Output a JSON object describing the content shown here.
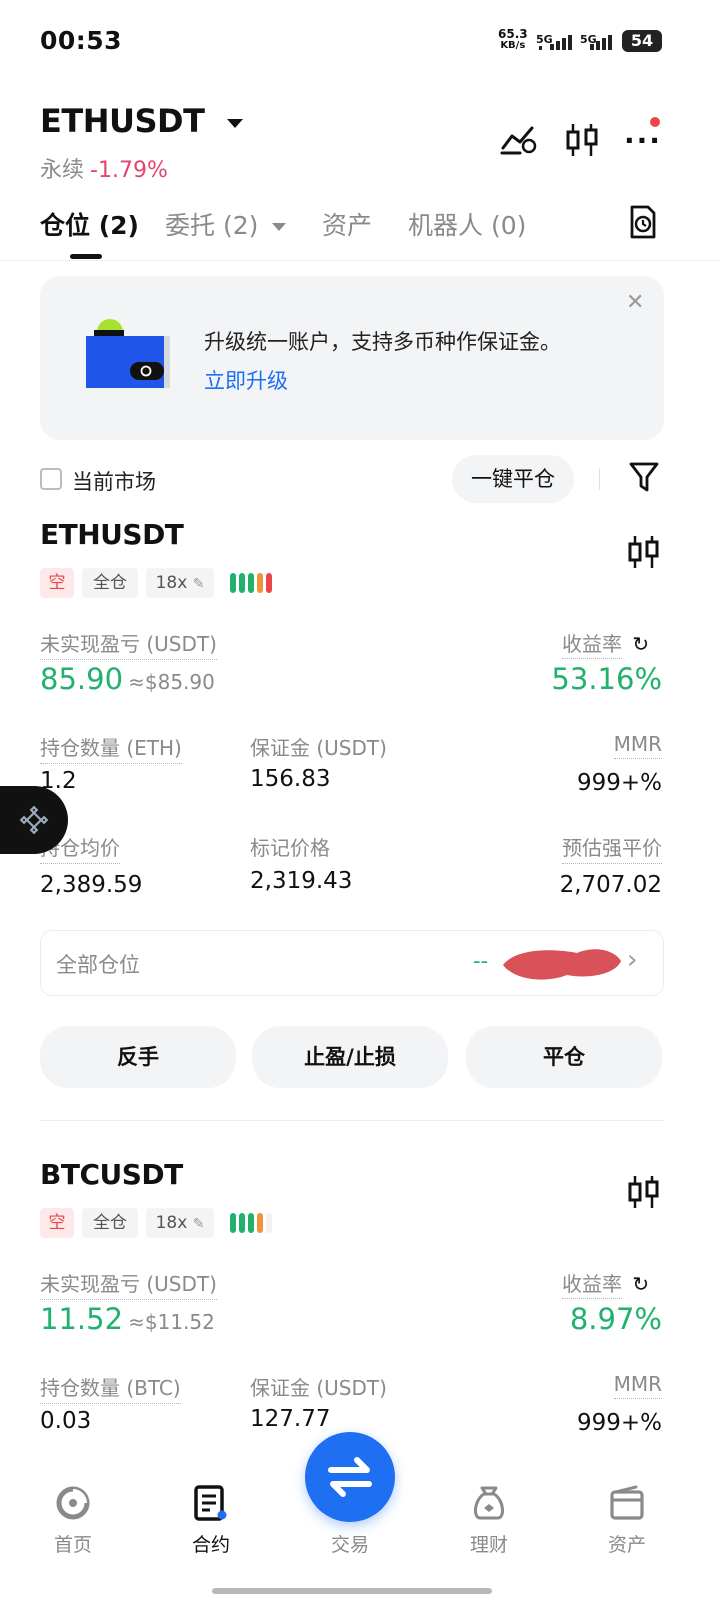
{
  "status_bar": {
    "time": "00:53",
    "net_speed_value": "65.3",
    "net_speed_unit": "KB/s",
    "sim1": "5G",
    "sim2": "5G",
    "battery": "54"
  },
  "header": {
    "symbol": "ETHUSDT",
    "contract_type": "永续",
    "change_pct": "-1.79%"
  },
  "tabs": [
    {
      "label": "仓位 (2)",
      "active": true
    },
    {
      "label": "委托 (2)",
      "active": false
    },
    {
      "label": "资产",
      "active": false
    },
    {
      "label": "机器人 (0)",
      "active": false
    }
  ],
  "banner": {
    "text": "升级统一账户，支持多币种作保证金。",
    "link": "立即升级"
  },
  "filter": {
    "current_market": "当前市场",
    "close_all": "一键平仓"
  },
  "positions": [
    {
      "symbol": "ETHUSDT",
      "side": "空",
      "margin_mode": "全仓",
      "leverage": "18x",
      "risk_bars_filled": 5,
      "unrealized_label": "未实现盈亏 (USDT)",
      "unrealized_value": "85.90",
      "unrealized_approx": "≈$85.90",
      "roe_label": "收益率",
      "roe_value": "53.16%",
      "qty_label": "持仓数量 (ETH)",
      "qty_value": "1.2",
      "margin_label": "保证金 (USDT)",
      "margin_value": "156.83",
      "mmr_label": "MMR",
      "mmr_value": "999+%",
      "entry_label": "持仓均价",
      "entry_value": "2,389.59",
      "mark_label": "标记价格",
      "mark_value": "2,319.43",
      "liq_label": "预估强平价",
      "liq_value": "2,707.02",
      "all_positions_label": "全部仓位",
      "all_positions_value": "--",
      "actions": [
        "反手",
        "止盈/止损",
        "平仓"
      ]
    },
    {
      "symbol": "BTCUSDT",
      "side": "空",
      "margin_mode": "全仓",
      "leverage": "18x",
      "risk_bars_filled": 4,
      "unrealized_label": "未实现盈亏 (USDT)",
      "unrealized_value": "11.52",
      "unrealized_approx": "≈$11.52",
      "roe_label": "收益率",
      "roe_value": "8.97%",
      "qty_label": "持仓数量 (BTC)",
      "qty_value": "0.03",
      "margin_label": "保证金 (USDT)",
      "margin_value": "127.77",
      "mmr_label": "MMR",
      "mmr_value": "999+%"
    }
  ],
  "bottom_nav": [
    {
      "label": "首页",
      "icon": "home-icon",
      "active": false
    },
    {
      "label": "合约",
      "icon": "futures-icon",
      "active": true
    },
    {
      "label": "交易",
      "icon": "swap-icon",
      "active": false
    },
    {
      "label": "理财",
      "icon": "earn-icon",
      "active": false
    },
    {
      "label": "资产",
      "icon": "wallet-icon",
      "active": false
    }
  ],
  "colors": {
    "profit_green": "#20b26c",
    "loss_red": "#e2456e",
    "liq_orange": "#f0913c",
    "brand_blue": "#1f6ff2"
  }
}
